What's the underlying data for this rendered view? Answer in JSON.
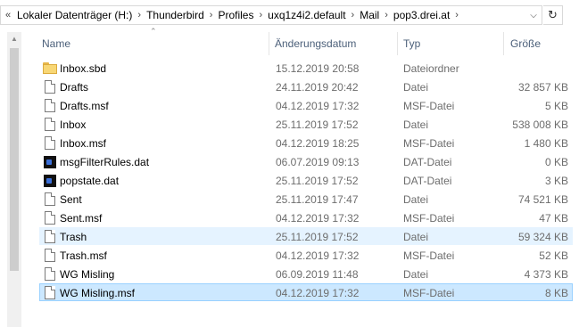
{
  "address_bar": {
    "overflow_glyph": "«",
    "crumbs": [
      "Lokaler Datenträger (H:)",
      "Thunderbird",
      "Profiles",
      "uxq1z4i2.default",
      "Mail",
      "pop3.drei.at"
    ],
    "separator": "›",
    "dropdown_glyph": "⌵",
    "refresh_glyph": "↻"
  },
  "columns": {
    "name": "Name",
    "date": "Änderungsdatum",
    "type": "Typ",
    "size": "Größe",
    "sort_glyph": "⌃"
  },
  "files": [
    {
      "name": "Inbox.sbd",
      "date": "15.12.2019 20:58",
      "type": "Dateiordner",
      "size": "",
      "icon": "folder-icon"
    },
    {
      "name": "Drafts",
      "date": "24.11.2019 20:42",
      "type": "Datei",
      "size": "32 857 KB",
      "icon": "file-icon"
    },
    {
      "name": "Drafts.msf",
      "date": "04.12.2019 17:32",
      "type": "MSF-Datei",
      "size": "5 KB",
      "icon": "file-icon"
    },
    {
      "name": "Inbox",
      "date": "25.11.2019 17:52",
      "type": "Datei",
      "size": "538 008 KB",
      "icon": "file-icon"
    },
    {
      "name": "Inbox.msf",
      "date": "04.12.2019 18:25",
      "type": "MSF-Datei",
      "size": "1 480 KB",
      "icon": "file-icon"
    },
    {
      "name": "msgFilterRules.dat",
      "date": "06.07.2019 09:13",
      "type": "DAT-Datei",
      "size": "0 KB",
      "icon": "dat-file-icon"
    },
    {
      "name": "popstate.dat",
      "date": "25.11.2019 17:52",
      "type": "DAT-Datei",
      "size": "3 KB",
      "icon": "dat-file-icon"
    },
    {
      "name": "Sent",
      "date": "25.11.2019 17:47",
      "type": "Datei",
      "size": "74 521 KB",
      "icon": "file-icon"
    },
    {
      "name": "Sent.msf",
      "date": "04.12.2019 17:32",
      "type": "MSF-Datei",
      "size": "47 KB",
      "icon": "file-icon"
    },
    {
      "name": "Trash",
      "date": "25.11.2019 17:52",
      "type": "Datei",
      "size": "59 324 KB",
      "icon": "file-icon",
      "state": "hover"
    },
    {
      "name": "Trash.msf",
      "date": "04.12.2019 17:32",
      "type": "MSF-Datei",
      "size": "52 KB",
      "icon": "file-icon"
    },
    {
      "name": "WG Misling",
      "date": "06.09.2019 11:48",
      "type": "Datei",
      "size": "4 373 KB",
      "icon": "file-icon"
    },
    {
      "name": "WG Misling.msf",
      "date": "04.12.2019 17:32",
      "type": "MSF-Datei",
      "size": "8 KB",
      "icon": "file-icon",
      "state": "selected"
    }
  ],
  "colors": {
    "selected_bg": "#cce8ff",
    "selected_border": "#99d1ff",
    "hover_bg": "#e5f3ff",
    "header_text": "#4c607a",
    "detail_text": "#6d6d6d",
    "folder_yellow": "#f8d775"
  }
}
